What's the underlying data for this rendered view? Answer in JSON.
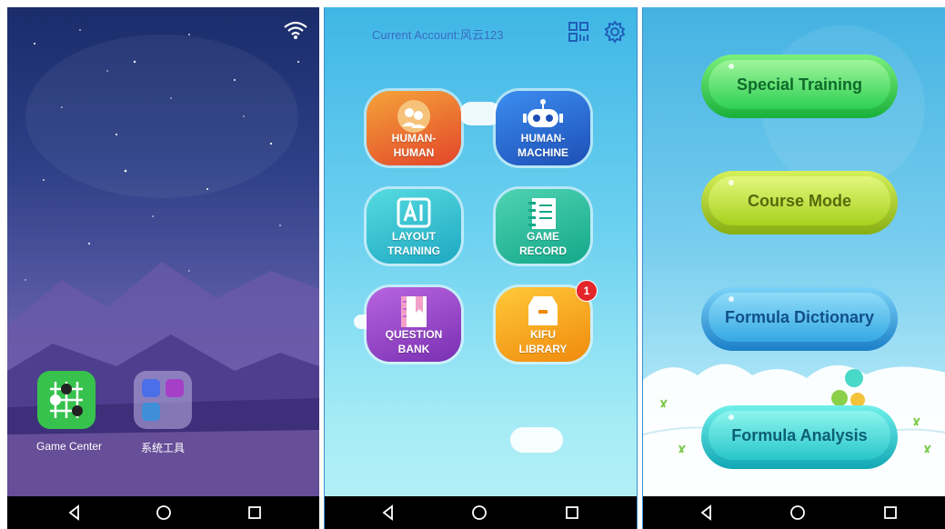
{
  "home": {
    "apps": [
      {
        "label": "Game Center"
      },
      {
        "label": "系统工具"
      }
    ]
  },
  "menu": {
    "account": "Current Account:风云123",
    "tiles": [
      {
        "line1": "HUMAN-",
        "line2": "HUMAN",
        "color": "#e8572a"
      },
      {
        "line1": "HUMAN-",
        "line2": "MACHINE",
        "color": "#2b6fd6"
      },
      {
        "line1": "LAYOUT",
        "line2": "TRAINING",
        "color": "#2cc1cf"
      },
      {
        "line1": "GAME",
        "line2": "RECORD",
        "color": "#20b69d"
      },
      {
        "line1": "QUESTION",
        "line2": "BANK",
        "color": "#8a3fc0"
      },
      {
        "line1": "KIFU",
        "line2": "LIBRARY",
        "color": "#f2a112"
      }
    ],
    "kifu_badge": "1"
  },
  "modes": {
    "buttons": [
      {
        "label": "Special Training",
        "color": "#2fcf55"
      },
      {
        "label": "Course Mode",
        "color": "#9bcd1a"
      },
      {
        "label": "Formula Dictionary",
        "color": "#2fa6e0"
      },
      {
        "label": "Formula Analysis",
        "color": "#22c4c4"
      }
    ]
  }
}
